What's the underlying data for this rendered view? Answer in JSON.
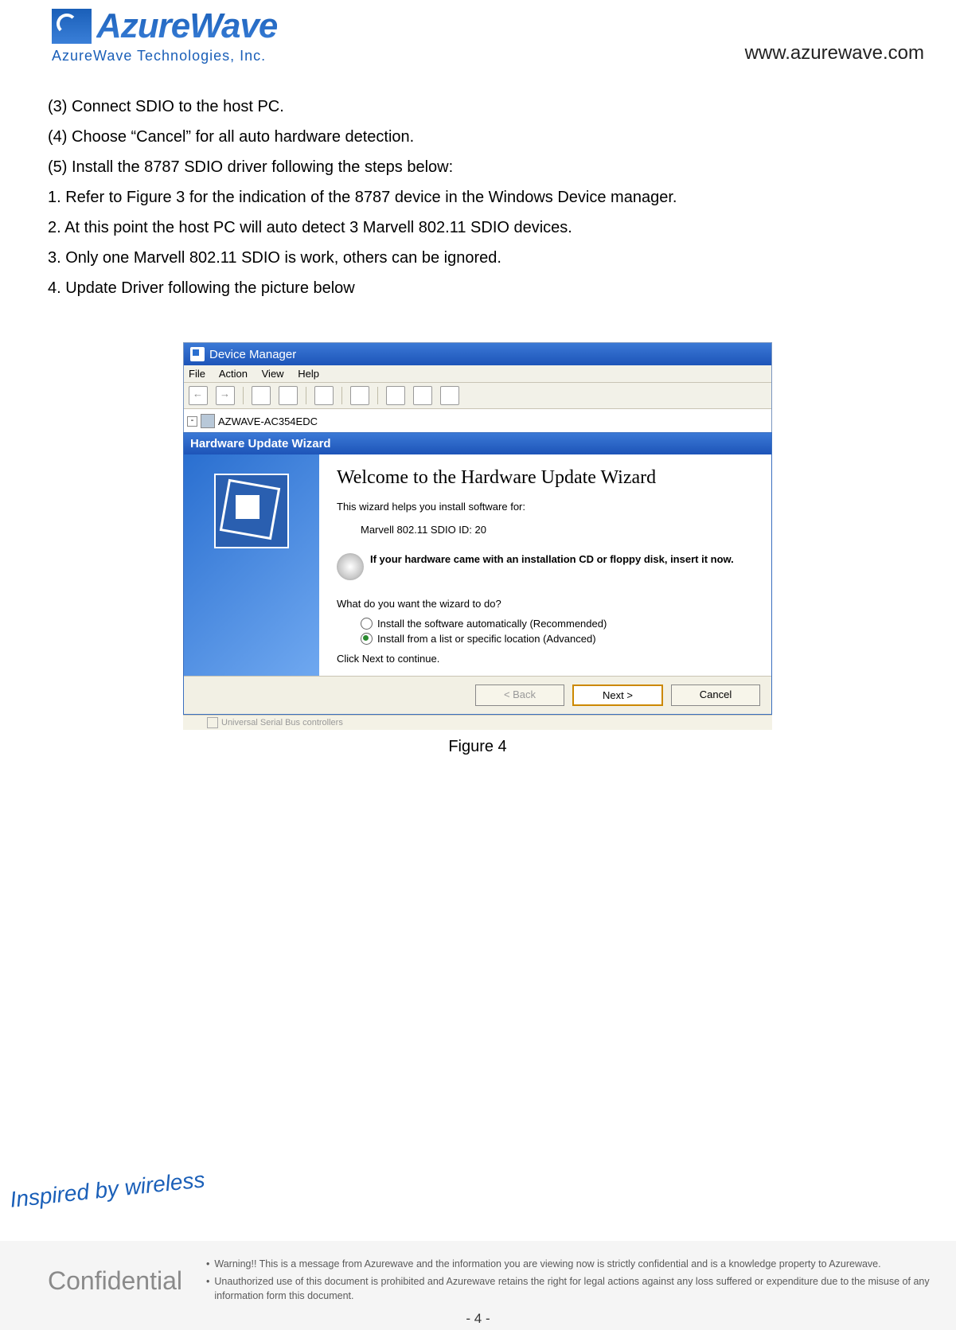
{
  "header": {
    "brand_main": "AzureWave",
    "brand_sub": "AzureWave  Technologies,  Inc.",
    "url": "www.azurewave.com"
  },
  "instructions": {
    "i3": "(3)  Connect SDIO to the host PC.",
    "i4": "(4)  Choose “Cancel” for all auto hardware detection.",
    "i5": "(5)  Install the 8787 SDIO driver following the steps below:",
    "s1": "1.   Refer to Figure 3 for the indication of the 8787 device in the Windows Device manager.",
    "s2": "2.   At this point the host PC will auto detect 3 Marvell 802.11 SDIO devices.",
    "s3": "3.   Only one Marvell 802.11 SDIO is work, others can be ignored.",
    "s4": "4.   Update Driver following the picture below"
  },
  "device_manager": {
    "title": "Device Manager",
    "menu": {
      "file": "File",
      "action": "Action",
      "view": "View",
      "help": "Help"
    },
    "tree_root_pm": "-",
    "tree_root": "AZWAVE-AC354EDC"
  },
  "wizard": {
    "title": "Hardware Update Wizard",
    "heading": "Welcome to the Hardware Update Wizard",
    "intro": "This wizard helps you install software for:",
    "device": "Marvell 802.11 SDIO ID: 20",
    "cd_notice": "If your hardware came with an installation CD or floppy disk, insert it now.",
    "question": "What do you want the wizard to do?",
    "opt_auto": "Install the software automatically (Recommended)",
    "opt_list": "Install from a list or specific location (Advanced)",
    "click_next": "Click Next to continue.",
    "btn_back": "< Back",
    "btn_next": "Next >",
    "btn_cancel": "Cancel",
    "cut_text": "Universal Serial Bus controllers"
  },
  "figure_caption": "Figure 4",
  "footer": {
    "slogan": "Inspired by wireless",
    "confidential": "Confidential",
    "warn1": "Warning!! This is a message from Azurewave and the information you are viewing now is strictly confidential and is a knowledge property to Azurewave.",
    "warn2": "Unauthorized use of this document is prohibited and Azurewave retains the right for legal actions against any loss suffered or expenditure due to the misuse of any information form this document.",
    "page": "- 4 -"
  }
}
